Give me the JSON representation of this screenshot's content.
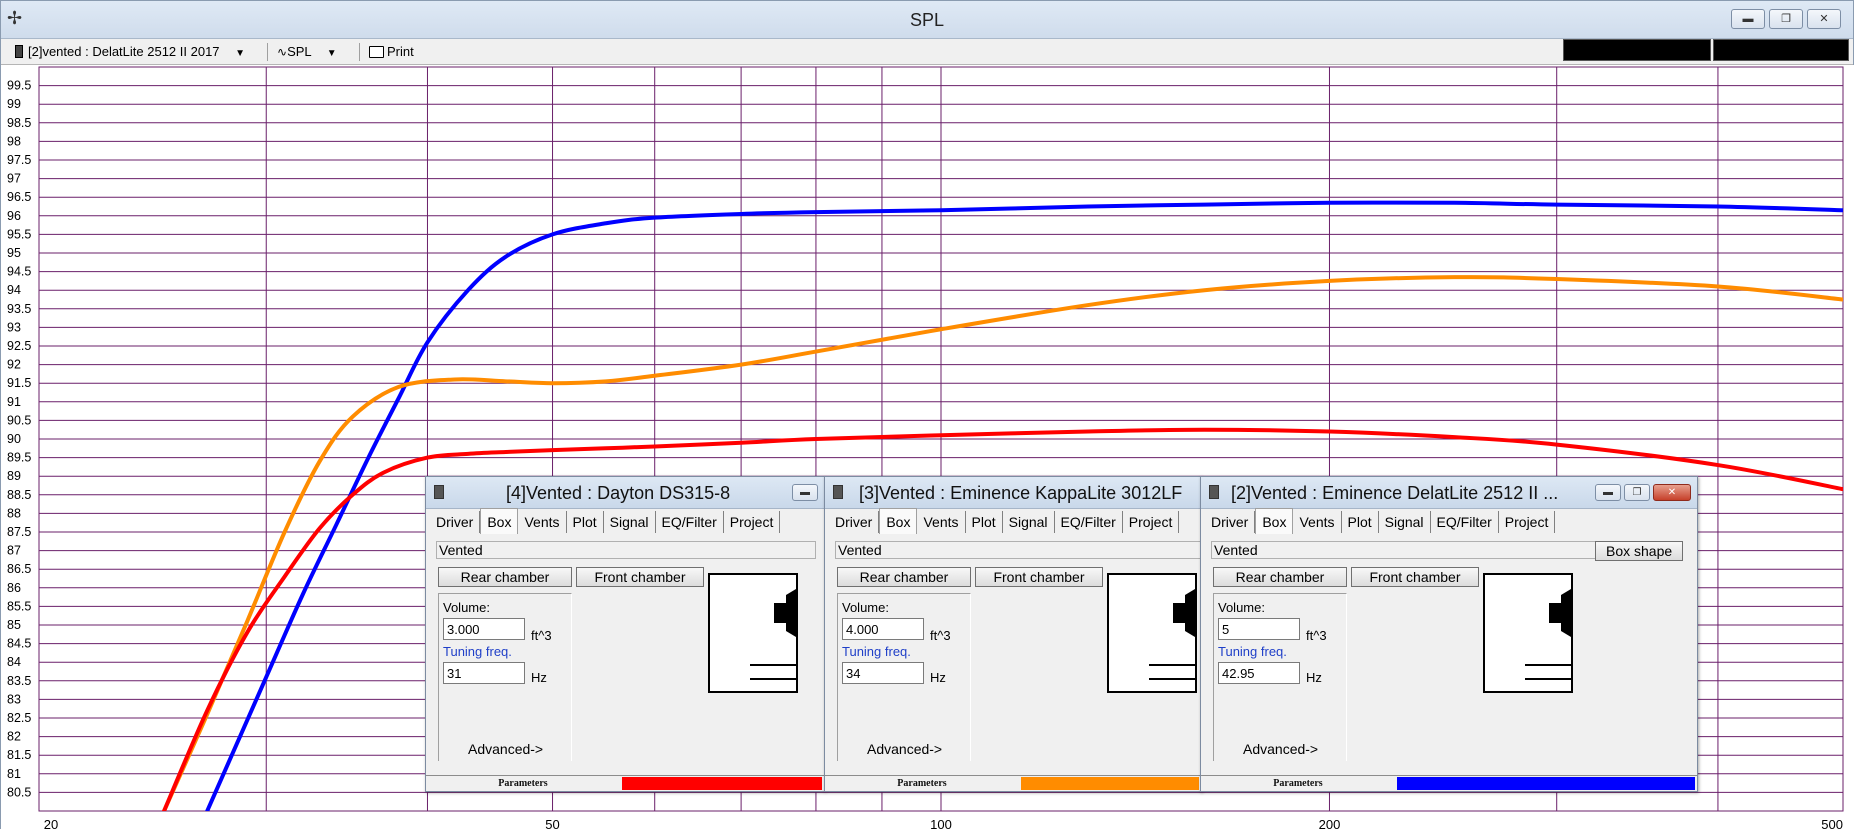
{
  "window": {
    "title": "SPL",
    "app_icon": "✢"
  },
  "toolbar": {
    "project": "[2]vented : DelatLite 2512 II 2017",
    "plot_mode": "SPL",
    "print": "Print"
  },
  "chart_data": {
    "type": "line",
    "title": "",
    "xlabel": "",
    "ylabel": "",
    "x_scale": "log",
    "xlim": [
      20,
      500
    ],
    "ylim": [
      80,
      100
    ],
    "grid": true,
    "x_tick_labels": [
      "20",
      "50",
      "100",
      "200",
      "500"
    ],
    "x_grid_values": [
      30,
      40,
      50,
      60,
      70,
      80,
      90,
      100,
      200,
      300,
      400
    ],
    "y_tick_labels": [
      "99.5",
      "99",
      "98.5",
      "98",
      "97.5",
      "97",
      "96.5",
      "96",
      "95.5",
      "95",
      "94.5",
      "94",
      "93.5",
      "93",
      "92.5",
      "92",
      "91.5",
      "91",
      "90.5",
      "90",
      "89.5",
      "89",
      "88.5",
      "88",
      "87.5",
      "87",
      "86.5",
      "86",
      "85.5",
      "85",
      "84.5",
      "84",
      "83.5",
      "83",
      "82.5",
      "82",
      "81.5",
      "81",
      "80.5"
    ],
    "series": [
      {
        "color": "#0000ff",
        "x": [
          27,
          30,
          32,
          34,
          36,
          38,
          40,
          43,
          46,
          50,
          55,
          60,
          70,
          80,
          100,
          130,
          160,
          200,
          250,
          300,
          400,
          500
        ],
        "y": [
          80.0,
          83.6,
          85.8,
          87.7,
          89.5,
          91.1,
          92.6,
          94.0,
          94.9,
          95.5,
          95.8,
          95.95,
          96.05,
          96.1,
          96.15,
          96.25,
          96.3,
          96.35,
          96.35,
          96.3,
          96.25,
          96.15
        ]
      },
      {
        "color": "#ff8c00",
        "x": [
          25,
          27,
          29,
          31,
          33,
          35,
          38,
          42,
          46,
          50,
          55,
          60,
          70,
          80,
          100,
          130,
          160,
          200,
          250,
          300,
          400,
          500
        ],
        "y": [
          80.0,
          82.6,
          85.1,
          87.5,
          89.4,
          90.6,
          91.4,
          91.6,
          91.55,
          91.5,
          91.55,
          91.7,
          92.0,
          92.35,
          92.95,
          93.6,
          94.0,
          94.25,
          94.35,
          94.3,
          94.1,
          93.75
        ]
      },
      {
        "color": "#ff0000",
        "x": [
          25,
          27,
          29,
          31,
          33,
          35,
          37,
          40,
          43,
          46,
          50,
          55,
          60,
          70,
          80,
          100,
          130,
          160,
          200,
          250,
          300,
          400,
          500
        ],
        "y": [
          80.0,
          82.7,
          84.8,
          86.3,
          87.6,
          88.5,
          89.1,
          89.5,
          89.6,
          89.65,
          89.7,
          89.75,
          89.8,
          89.9,
          90.0,
          90.1,
          90.2,
          90.25,
          90.2,
          90.05,
          89.85,
          89.3,
          88.65
        ]
      }
    ]
  },
  "child_windows": [
    {
      "title": "[4]Vented : Dayton DS315-8",
      "volume": "3.000",
      "tuning": "31",
      "status_color": "#ff0000"
    },
    {
      "title": "[3]Vented : Eminence KappaLite 3012LF",
      "volume": "4.000",
      "tuning": "34",
      "status_color": "#ff8c00"
    },
    {
      "title": "[2]Vented : Eminence DelatLite 2512 II ...",
      "volume": "5",
      "tuning": "42.95",
      "status_color": "#0000ff"
    }
  ],
  "tabs": [
    "Driver",
    "Box",
    "Vents",
    "Plot",
    "Signal",
    "EQ/Filter",
    "Project"
  ],
  "box": {
    "type": "Vented",
    "box_shape": "Box shape",
    "rear": "Rear chamber",
    "front": "Front chamber",
    "volume_label": "Volume:",
    "volume_unit": "ft^3",
    "tuning_label": "Tuning freq.",
    "tuning_unit": "Hz",
    "advanced": "Advanced->",
    "parameters": "Parameters"
  }
}
